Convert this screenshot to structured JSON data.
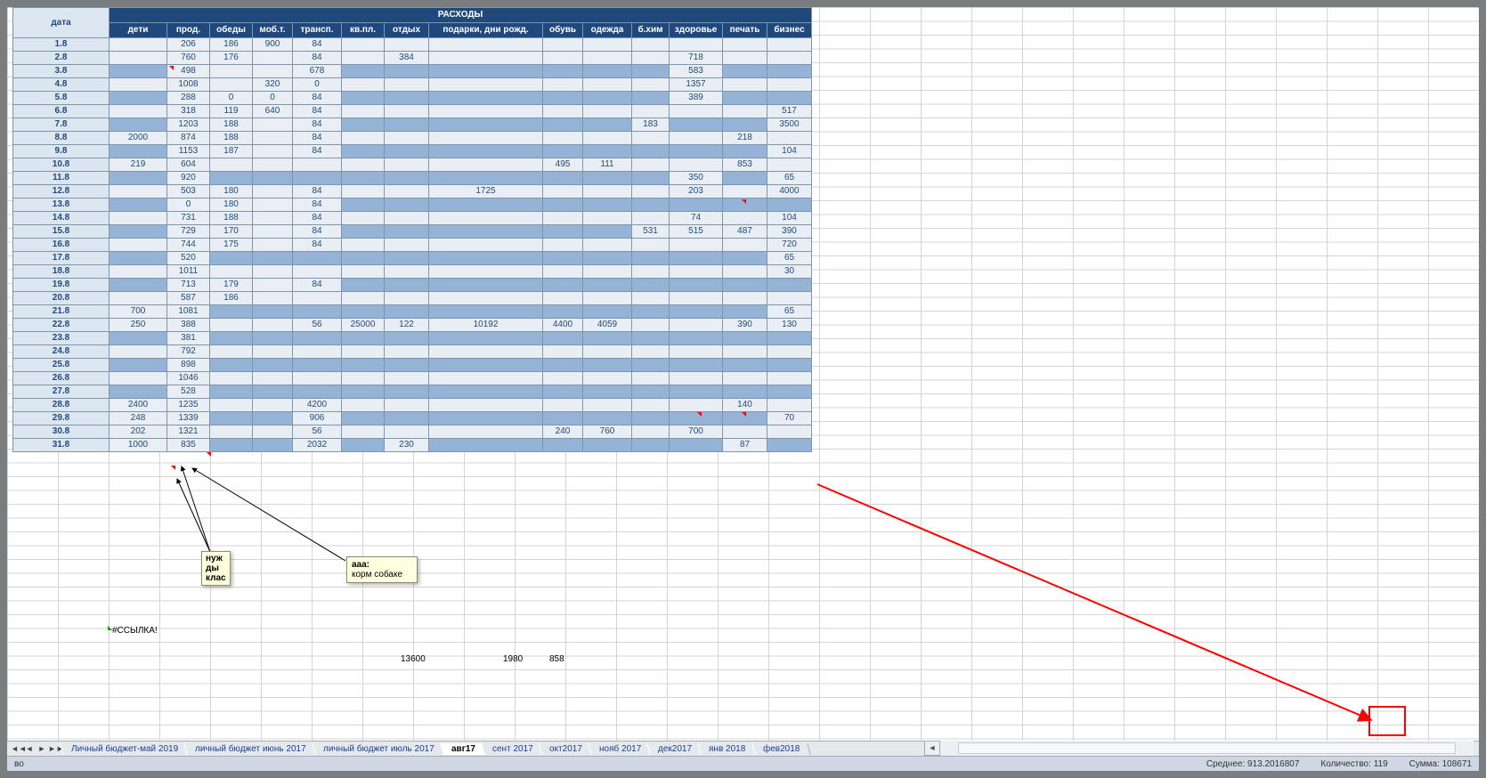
{
  "headers": {
    "date": "дата",
    "main_title": "РАСХОДЫ"
  },
  "columns": [
    "дети",
    "прод.",
    "обеды",
    "моб.т.",
    "трансп.",
    "кв.пл.",
    "отдых",
    "подарки, дни рожд.",
    "обувь",
    "одежда",
    "б.хим",
    "здоровье",
    "печать",
    "бизнес"
  ],
  "rows": [
    {
      "date": "1.8",
      "vals": [
        "",
        "206",
        "186",
        "900",
        "84",
        "",
        "",
        "",
        "",
        "",
        "",
        "",
        "",
        ""
      ],
      "dark": []
    },
    {
      "date": "2.8",
      "vals": [
        "",
        "760",
        "176",
        "",
        "84",
        "",
        "384",
        "",
        "",
        "",
        "",
        "718",
        "",
        ""
      ],
      "dark": []
    },
    {
      "date": "3.8",
      "vals": [
        "",
        "498",
        "",
        "",
        "678",
        "",
        "",
        "",
        "",
        "",
        "",
        "583",
        "",
        ""
      ],
      "dark": [
        0,
        5,
        6,
        7,
        8,
        9,
        10,
        12,
        13
      ]
    },
    {
      "date": "4.8",
      "vals": [
        "",
        "1008",
        "",
        "320",
        "0",
        "",
        "",
        "",
        "",
        "",
        "",
        "1357",
        "",
        ""
      ],
      "dark": []
    },
    {
      "date": "5.8",
      "vals": [
        "",
        "288",
        "0",
        "0",
        "84",
        "",
        "",
        "",
        "",
        "",
        "",
        "389",
        "",
        ""
      ],
      "dark": [
        0,
        5,
        6,
        7,
        8,
        9,
        10,
        12,
        13
      ]
    },
    {
      "date": "6.8",
      "vals": [
        "",
        "318",
        "119",
        "640",
        "84",
        "",
        "",
        "",
        "",
        "",
        "",
        "",
        "",
        "517"
      ],
      "dark": []
    },
    {
      "date": "7.8",
      "vals": [
        "",
        "1203",
        "188",
        "",
        "84",
        "",
        "",
        "",
        "",
        "",
        "183",
        "",
        "",
        "3500"
      ],
      "dark": [
        0,
        5,
        6,
        7,
        8,
        9,
        11,
        12
      ]
    },
    {
      "date": "8.8",
      "vals": [
        "2000",
        "874",
        "188",
        "",
        "84",
        "",
        "",
        "",
        "",
        "",
        "",
        "",
        "218",
        ""
      ],
      "dark": []
    },
    {
      "date": "9.8",
      "vals": [
        "",
        "1153",
        "187",
        "",
        "84",
        "",
        "",
        "",
        "",
        "",
        "",
        "",
        "",
        "104"
      ],
      "dark": [
        0,
        5,
        6,
        7,
        8,
        9,
        10,
        11,
        12
      ]
    },
    {
      "date": "10.8",
      "vals": [
        "219",
        "604",
        "",
        "",
        "",
        "",
        "",
        "",
        "495",
        "111",
        "",
        "",
        "853",
        ""
      ],
      "dark": []
    },
    {
      "date": "11.8",
      "vals": [
        "",
        "920",
        "",
        "",
        "",
        "",
        "",
        "",
        "",
        "",
        "",
        "350",
        "",
        "65"
      ],
      "dark": [
        0,
        2,
        3,
        4,
        5,
        6,
        7,
        8,
        9,
        10,
        12
      ]
    },
    {
      "date": "12.8",
      "vals": [
        "",
        "503",
        "180",
        "",
        "84",
        "",
        "",
        "1725",
        "",
        "",
        "",
        "203",
        "",
        "4000"
      ],
      "dark": []
    },
    {
      "date": "13.8",
      "vals": [
        "",
        "0",
        "180",
        "",
        "84",
        "",
        "",
        "",
        "",
        "",
        "",
        "",
        "",
        ""
      ],
      "dark": [
        0,
        5,
        6,
        7,
        8,
        9,
        10,
        11,
        12,
        13
      ]
    },
    {
      "date": "14.8",
      "vals": [
        "",
        "731",
        "188",
        "",
        "84",
        "",
        "",
        "",
        "",
        "",
        "",
        "74",
        "",
        "104"
      ],
      "dark": []
    },
    {
      "date": "15.8",
      "vals": [
        "",
        "729",
        "170",
        "",
        "84",
        "",
        "",
        "",
        "",
        "",
        "531",
        "515",
        "487",
        "390"
      ],
      "dark": [
        0,
        5,
        6,
        7,
        8,
        9
      ]
    },
    {
      "date": "16.8",
      "vals": [
        "",
        "744",
        "175",
        "",
        "84",
        "",
        "",
        "",
        "",
        "",
        "",
        "",
        "",
        "720"
      ],
      "dark": []
    },
    {
      "date": "17.8",
      "vals": [
        "",
        "520",
        "",
        "",
        "",
        "",
        "",
        "",
        "",
        "",
        "",
        "",
        "",
        "65"
      ],
      "dark": [
        0,
        2,
        3,
        4,
        5,
        6,
        7,
        8,
        9,
        10,
        11,
        12
      ]
    },
    {
      "date": "18.8",
      "vals": [
        "",
        "1011",
        "",
        "",
        "",
        "",
        "",
        "",
        "",
        "",
        "",
        "",
        "",
        "30"
      ],
      "dark": []
    },
    {
      "date": "19.8",
      "vals": [
        "",
        "713",
        "179",
        "",
        "84",
        "",
        "",
        "",
        "",
        "",
        "",
        "",
        "",
        ""
      ],
      "dark": [
        0,
        5,
        6,
        7,
        8,
        9,
        10,
        11,
        12,
        13
      ]
    },
    {
      "date": "20.8",
      "vals": [
        "",
        "587",
        "186",
        "",
        "",
        "",
        "",
        "",
        "",
        "",
        "",
        "",
        "",
        ""
      ],
      "dark": []
    },
    {
      "date": "21.8",
      "vals": [
        "700",
        "1081",
        "",
        "",
        "",
        "",
        "",
        "",
        "",
        "",
        "",
        "",
        "",
        "65"
      ],
      "dark": [
        2,
        3,
        4,
        5,
        6,
        7,
        8,
        9,
        10,
        11,
        12
      ]
    },
    {
      "date": "22.8",
      "vals": [
        "250",
        "388",
        "",
        "",
        "56",
        "25000",
        "122",
        "10192",
        "4400",
        "4059",
        "",
        "",
        "390",
        "130"
      ],
      "dark": []
    },
    {
      "date": "23.8",
      "vals": [
        "",
        "381",
        "",
        "",
        "",
        "",
        "",
        "",
        "",
        "",
        "",
        "",
        "",
        ""
      ],
      "dark": [
        0,
        2,
        3,
        4,
        5,
        6,
        7,
        8,
        9,
        10,
        11,
        12,
        13
      ]
    },
    {
      "date": "24.8",
      "vals": [
        "",
        "792",
        "",
        "",
        "",
        "",
        "",
        "",
        "",
        "",
        "",
        "",
        "",
        ""
      ],
      "dark": []
    },
    {
      "date": "25.8",
      "vals": [
        "",
        "898",
        "",
        "",
        "",
        "",
        "",
        "",
        "",
        "",
        "",
        "",
        "",
        ""
      ],
      "dark": [
        0,
        2,
        3,
        4,
        5,
        6,
        7,
        8,
        9,
        10,
        11,
        12,
        13
      ]
    },
    {
      "date": "26.8",
      "vals": [
        "",
        "1046",
        "",
        "",
        "",
        "",
        "",
        "",
        "",
        "",
        "",
        "",
        "",
        ""
      ],
      "dark": []
    },
    {
      "date": "27.8",
      "vals": [
        "",
        "528",
        "",
        "",
        "",
        "",
        "",
        "",
        "",
        "",
        "",
        "",
        "",
        ""
      ],
      "dark": [
        0,
        2,
        3,
        4,
        5,
        6,
        7,
        8,
        9,
        10,
        11,
        12,
        13
      ]
    },
    {
      "date": "28.8",
      "vals": [
        "2400",
        "1235",
        "",
        "",
        "4200",
        "",
        "",
        "",
        "",
        "",
        "",
        "",
        "140",
        ""
      ],
      "dark": []
    },
    {
      "date": "29.8",
      "vals": [
        "248",
        "1339",
        "",
        "",
        "906",
        "",
        "",
        "",
        "",
        "",
        "",
        "",
        "",
        "70"
      ],
      "dark": [
        2,
        3,
        5,
        6,
        7,
        8,
        9,
        10,
        11,
        12
      ]
    },
    {
      "date": "30.8",
      "vals": [
        "202",
        "1321",
        "",
        "",
        "56",
        "",
        "",
        "",
        "240",
        "760",
        "",
        "700",
        "",
        ""
      ],
      "dark": []
    },
    {
      "date": "31.8",
      "vals": [
        "1000",
        "835",
        "",
        "",
        "2032",
        "",
        "230",
        "",
        "",
        "",
        "",
        "",
        "87",
        ""
      ],
      "dark": [
        2,
        3,
        5,
        7,
        8,
        9,
        10,
        11,
        13
      ]
    }
  ],
  "annotations": {
    "box1": {
      "lines": [
        "нуж",
        "ды",
        "клас"
      ]
    },
    "box2": {
      "title": "aaa:",
      "text": "корм собаке"
    }
  },
  "loose_cells": {
    "ref_error": "#ССЫЛКА!",
    "n1": "13600",
    "n2": "1980",
    "n3": "858"
  },
  "tabs": [
    "Личный бюджет-май 2019",
    "личный бюджет июнь 2017",
    "личный бюджет  июль 2017",
    "авг17",
    "сент 2017",
    "окт2017",
    "нояб 2017",
    "дек2017",
    "янв 2018",
    "фев2018"
  ],
  "active_tab_index": 3,
  "status": {
    "left": "во",
    "avg_lbl": "Среднее:",
    "avg": "913.2016807",
    "cnt_lbl": "Количество:",
    "cnt": "119",
    "sum_lbl": "Сумма:",
    "sum": "108671"
  }
}
